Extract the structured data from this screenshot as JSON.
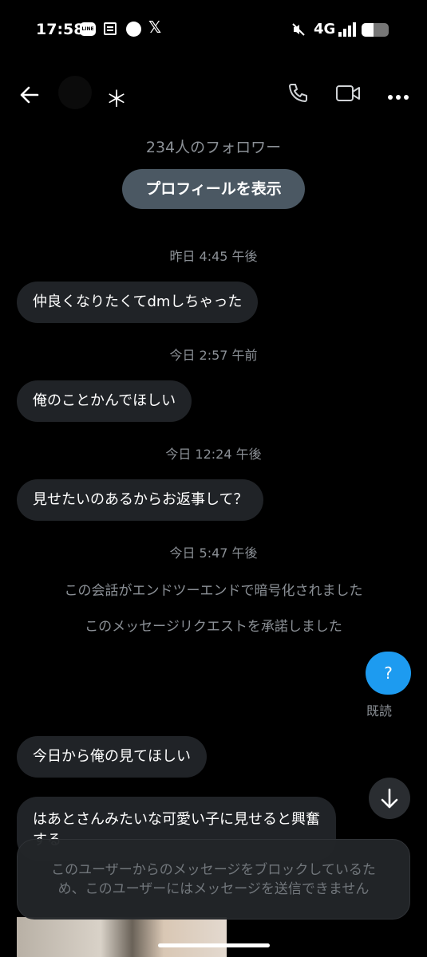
{
  "status_bar": {
    "time": "17:58",
    "line_icon_text": "LINE",
    "network": "4G",
    "battery_level": 0.45
  },
  "header": {
    "name": "＊",
    "back_icon": "arrow-left-icon",
    "call_icon": "phone-icon",
    "video_icon": "video-camera-icon",
    "more_icon": "more-horizontal-icon"
  },
  "profile": {
    "followers": "234人のフォロワー",
    "view_profile_label": "プロフィールを表示"
  },
  "conversation": {
    "ts1": "昨日 4:45 午後",
    "msg1": "仲良くなりたくてdmしちゃった",
    "ts2": "今日 2:57 午前",
    "msg2": "俺のことかんでほしい",
    "ts3": "今日 12:24 午後",
    "msg3": "見せたいのあるからお返事して？",
    "ts4": "今日 5:47 午後",
    "system1": "この会話がエンドツーエンドで暗号化されました",
    "system2": "このメッセージリクエストを承諾しました",
    "sent_msg": "?",
    "read_status": "既読",
    "msg4": "今日から俺の見てほしい",
    "msg5": "はあとさんみたいな可愛い子に見せると興奮する"
  },
  "blocked_notice": "このユーザーからのメッセージをブロックしているため、このユーザーにはメッセージを送信できません",
  "colors": {
    "background": "#000000",
    "bubble": "#202327",
    "sent_bubble": "#1d9bf0",
    "muted_text": "#8b9096"
  }
}
